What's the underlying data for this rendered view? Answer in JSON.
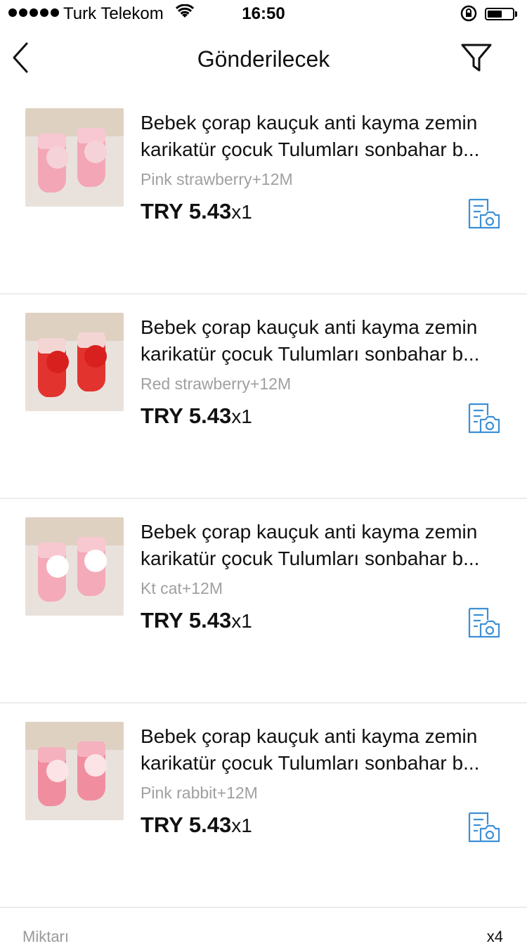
{
  "status_bar": {
    "carrier": "Turk Telekom",
    "time": "16:50",
    "battery_level": 0.6
  },
  "nav": {
    "title": "Gönderilecek",
    "back_icon": "chevron-left-icon",
    "filter_icon": "filter-icon"
  },
  "items": [
    {
      "title_line1": "Bebek çorap kauçuk anti kayma zemin",
      "title_line2": "karikatür çocuk Tulumları sonbahar b...",
      "variant": "Pink strawberry+12M",
      "price": "TRY 5.43",
      "qty": "x1",
      "thumb_colors": {
        "sock": "#f3a7b6",
        "accent": "#f7c8d2",
        "deco": "#f5d2d8"
      }
    },
    {
      "title_line1": "Bebek çorap kauçuk anti kayma zemin",
      "title_line2": "karikatür çocuk Tulumları sonbahar b...",
      "variant": "Red strawberry+12M",
      "price": "TRY 5.43",
      "qty": "x1",
      "thumb_colors": {
        "sock": "#e2332f",
        "accent": "#f3d6d4",
        "deco": "#d8201f"
      }
    },
    {
      "title_line1": "Bebek çorap kauçuk anti kayma zemin",
      "title_line2": "karikatür çocuk Tulumları sonbahar b...",
      "variant": "Kt cat+12M",
      "price": "TRY 5.43",
      "qty": "x1",
      "thumb_colors": {
        "sock": "#f4aab8",
        "accent": "#f8c8d1",
        "deco": "#ffffff"
      }
    },
    {
      "title_line1": "Bebek çorap kauçuk anti kayma zemin",
      "title_line2": "karikatür çocuk Tulumları sonbahar b...",
      "variant": "Pink rabbit+12M",
      "price": "TRY 5.43",
      "qty": "x1",
      "thumb_colors": {
        "sock": "#f08ea0",
        "accent": "#f5b1be",
        "deco": "#fbe3e6"
      }
    }
  ],
  "summary": {
    "label": "Miktarı",
    "count": "x4"
  },
  "colors": {
    "icon_blue": "#3d8fd6",
    "divider": "#ececec",
    "muted_text": "#a0a0a0"
  }
}
